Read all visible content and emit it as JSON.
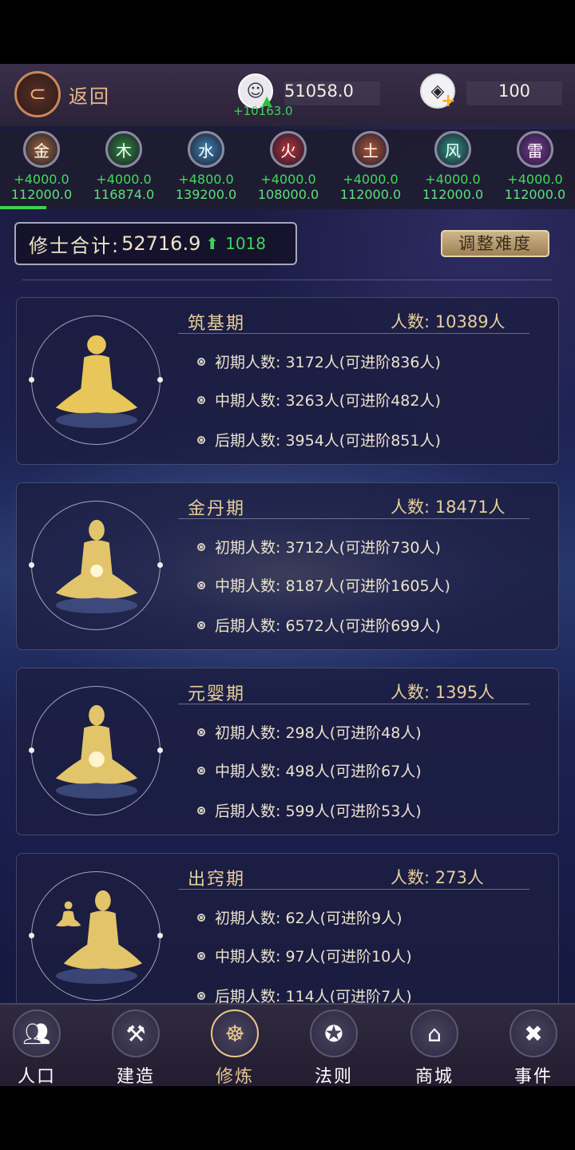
{
  "header": {
    "back_label": "返回",
    "population": "51058.0",
    "population_delta": "+10163.0",
    "gems": "100"
  },
  "elements": [
    {
      "name": "金",
      "rate": "+4000.0",
      "total": "112000.0",
      "color": "#a06a3c"
    },
    {
      "name": "木",
      "rate": "+4000.0",
      "total": "116874.0",
      "color": "#2e8a3a"
    },
    {
      "name": "水",
      "rate": "+4800.0",
      "total": "139200.0",
      "color": "#3e86b8"
    },
    {
      "name": "火",
      "rate": "+4000.0",
      "total": "108000.0",
      "color": "#b8323a"
    },
    {
      "name": "土",
      "rate": "+4000.0",
      "total": "112000.0",
      "color": "#b0583a"
    },
    {
      "name": "风",
      "rate": "+4000.0",
      "total": "112000.0",
      "color": "#2e9a8a"
    },
    {
      "name": "雷",
      "rate": "+4000.0",
      "total": "112000.0",
      "color": "#7a3a9a"
    }
  ],
  "summary": {
    "label": "修士合计:",
    "value": "52716.9",
    "delta": "1018",
    "adjust_label": "调整难度"
  },
  "stages": [
    {
      "title": "筑基期",
      "count": "人数: 10389人",
      "rows": [
        "初期人数: 3172人(可进阶836人)",
        "中期人数: 3263人(可进阶482人)",
        "后期人数: 3954人(可进阶851人)"
      ]
    },
    {
      "title": "金丹期",
      "count": "人数: 18471人",
      "rows": [
        "初期人数: 3712人(可进阶730人)",
        "中期人数: 8187人(可进阶1605人)",
        "后期人数: 6572人(可进阶699人)"
      ]
    },
    {
      "title": "元婴期",
      "count": "人数: 1395人",
      "rows": [
        "初期人数: 298人(可进阶48人)",
        "中期人数: 498人(可进阶67人)",
        "后期人数: 599人(可进阶53人)"
      ]
    },
    {
      "title": "出窍期",
      "count": "人数: 273人",
      "rows": [
        "初期人数: 62人(可进阶9人)",
        "中期人数: 97人(可进阶10人)",
        "后期人数: 114人(可进阶7人)"
      ]
    }
  ],
  "nav": [
    {
      "label": "人口",
      "icon": "people-icon"
    },
    {
      "label": "建造",
      "icon": "tools-icon"
    },
    {
      "label": "修炼",
      "icon": "meditate-icon"
    },
    {
      "label": "法则",
      "icon": "law-book-icon"
    },
    {
      "label": "商城",
      "icon": "shop-icon"
    },
    {
      "label": "事件",
      "icon": "event-book-icon"
    }
  ]
}
